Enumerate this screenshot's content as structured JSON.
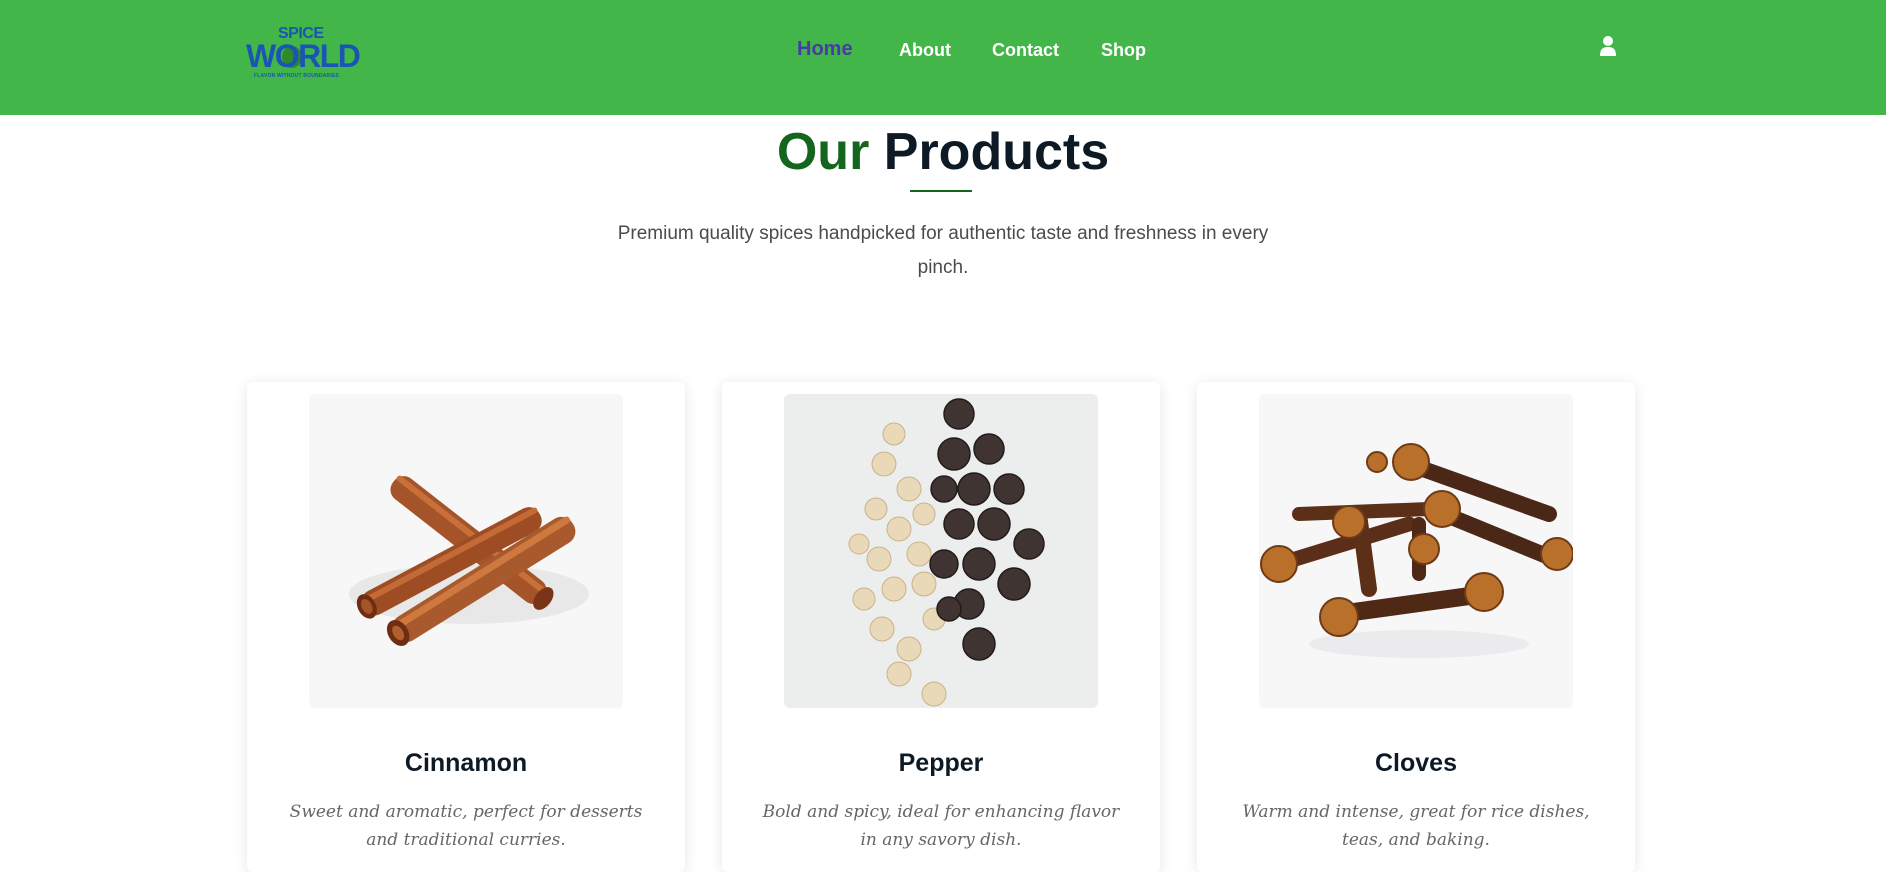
{
  "header": {
    "logo": {
      "top_text": "SPICE",
      "main_text": "WORLD",
      "tagline": "FLAVOR WITHOUT BOUNDARIES"
    },
    "nav": [
      {
        "label": "Home",
        "active": true
      },
      {
        "label": "About",
        "active": false
      },
      {
        "label": "Contact",
        "active": false
      },
      {
        "label": "Shop",
        "active": false
      }
    ],
    "user_icon": "user-icon",
    "bg_color": "#42b649",
    "active_color": "#4a3aa8"
  },
  "hero": {
    "title_accent": "Our",
    "title_main": "Products",
    "subtitle": "Premium quality spices handpicked for authentic taste and freshness in every pinch."
  },
  "products": [
    {
      "name": "Cinnamon",
      "description": "Sweet and aromatic, perfect for desserts and traditional curries.",
      "image_icon": "cinnamon-image"
    },
    {
      "name": "Pepper",
      "description": "Bold and spicy, ideal for enhancing flavor in any savory dish.",
      "image_icon": "pepper-image"
    },
    {
      "name": "Cloves",
      "description": "Warm and intense, great for rice dishes, teas, and baking.",
      "image_icon": "cloves-image"
    }
  ],
  "colors": {
    "accent_green": "#14661e",
    "heading_dark": "#0d1a26"
  }
}
